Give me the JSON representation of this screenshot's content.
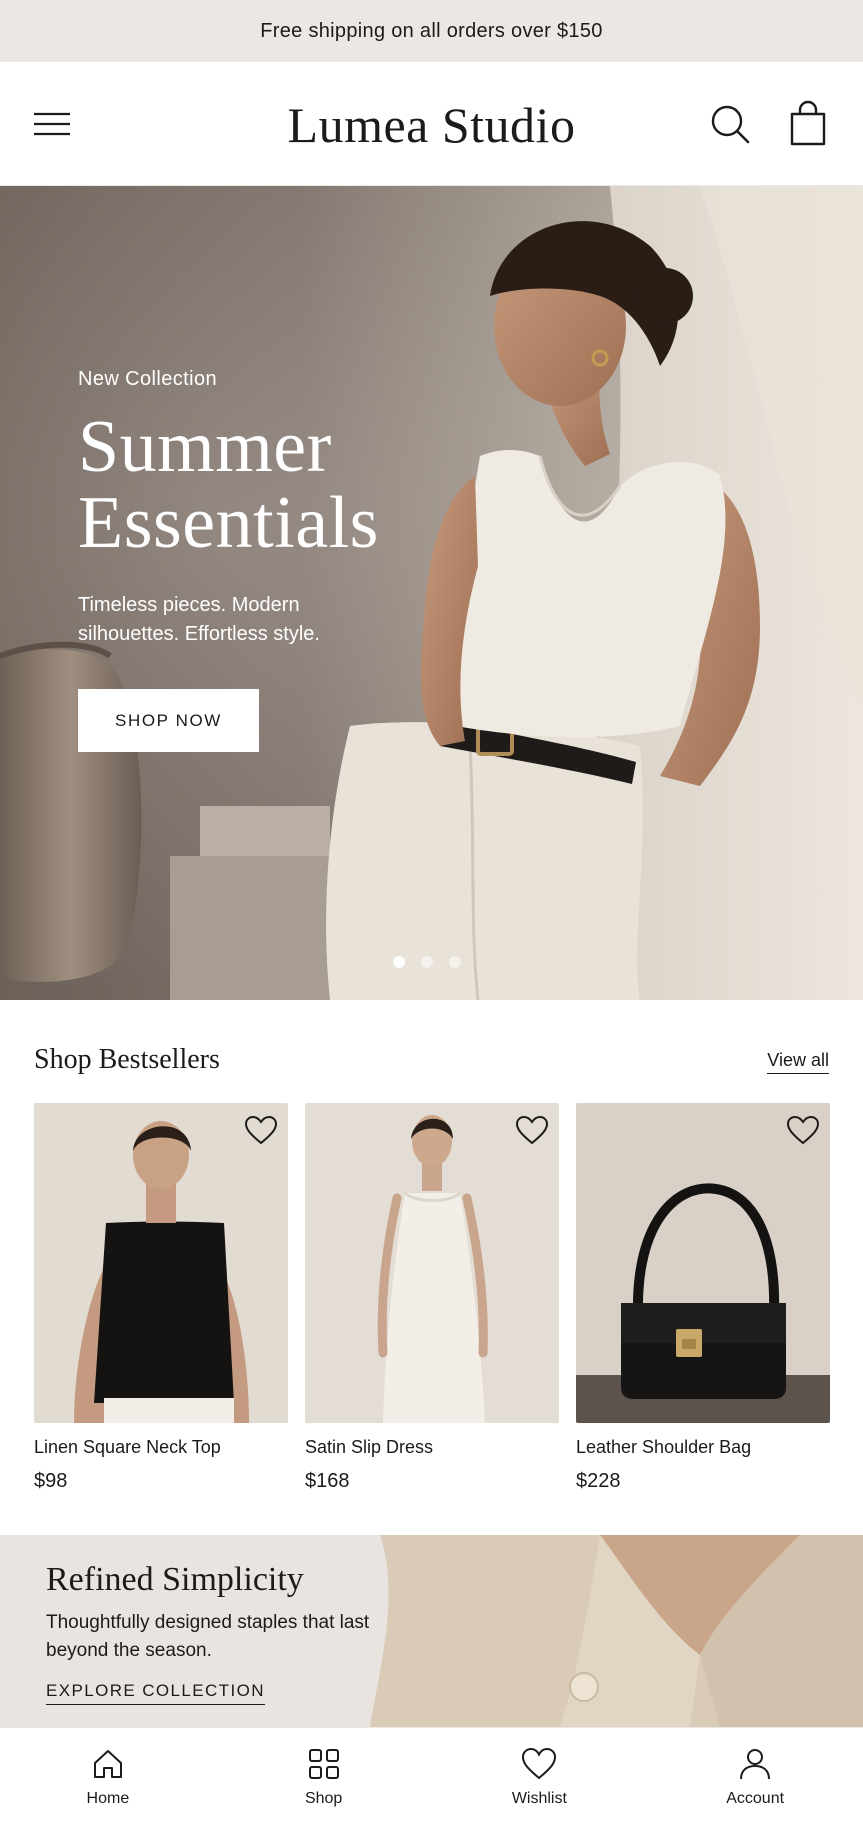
{
  "announcement": {
    "text": "Free shipping on all orders over $150"
  },
  "header": {
    "brand": "Lumea Studio",
    "menu_icon": "hamburger-menu-icon",
    "search_icon": "search-icon",
    "bag_icon": "shopping-bag-icon"
  },
  "hero": {
    "eyebrow": "New Collection",
    "title_line1": "Summer",
    "title_line2": "Essentials",
    "subtitle": "Timeless pieces. Modern silhouettes. Effortless style.",
    "cta": "SHOP NOW",
    "slides_total": 3,
    "active_slide": 1
  },
  "bestsellers": {
    "title": "Shop Bestsellers",
    "view_all": "View all",
    "products": [
      {
        "name": "Linen Square Neck Top",
        "price": "$98"
      },
      {
        "name": "Satin Slip Dress",
        "price": "$168"
      },
      {
        "name": "Leather Shoulder Bag",
        "price": "$228"
      }
    ]
  },
  "promo": {
    "title": "Refined Simplicity",
    "subtitle": "Thoughtfully designed staples that last beyond the season.",
    "cta": "EXPLORE COLLECTION"
  },
  "bottom_nav": {
    "items": [
      {
        "label": "Home",
        "icon": "home-icon"
      },
      {
        "label": "Shop",
        "icon": "grid-icon"
      },
      {
        "label": "Wishlist",
        "icon": "heart-icon"
      },
      {
        "label": "Account",
        "icon": "user-icon"
      }
    ]
  },
  "colors": {
    "announcement_bg": "#ebe7e3",
    "text": "#1d1b19",
    "promo_bg": "#e9e4df",
    "hero_text": "#ffffff"
  }
}
